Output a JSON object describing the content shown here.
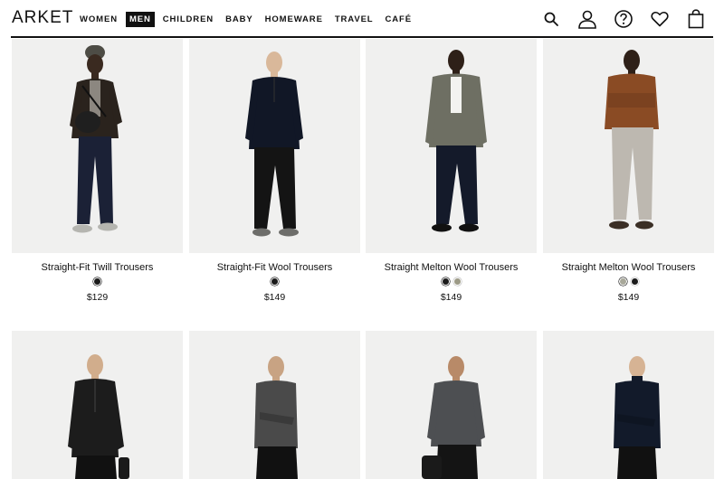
{
  "brand": {
    "logo": "ARKET"
  },
  "nav": [
    {
      "label": "WOMEN",
      "active": false
    },
    {
      "label": "MEN",
      "active": true
    },
    {
      "label": "CHILDREN",
      "active": false
    },
    {
      "label": "BABY",
      "active": false
    },
    {
      "label": "HOMEWARE",
      "active": false
    },
    {
      "label": "TRAVEL",
      "active": false
    },
    {
      "label": "CAFÉ",
      "active": false
    }
  ],
  "header_icons": [
    "search-icon",
    "account-icon",
    "help-icon",
    "wishlist-icon",
    "bag-icon"
  ],
  "products": [
    {
      "name": "Straight-Fit Twill Trousers",
      "price": "$129",
      "swatches": [
        "#1a1a1a"
      ]
    },
    {
      "name": "Straight-Fit Wool Trousers",
      "price": "$149",
      "swatches": [
        "#1a1a1a"
      ]
    },
    {
      "name": "Straight Melton Wool Trousers",
      "price": "$149",
      "swatches": [
        "#1a1a1a",
        "#9c9a86"
      ]
    },
    {
      "name": "Straight Melton Wool Trousers",
      "price": "$149",
      "swatches": [
        "#a8a89a",
        "#1a1a1a"
      ]
    }
  ],
  "colors": {
    "text": "#111111",
    "photo_bg": "#f0f0ef",
    "accent": "#111111"
  }
}
